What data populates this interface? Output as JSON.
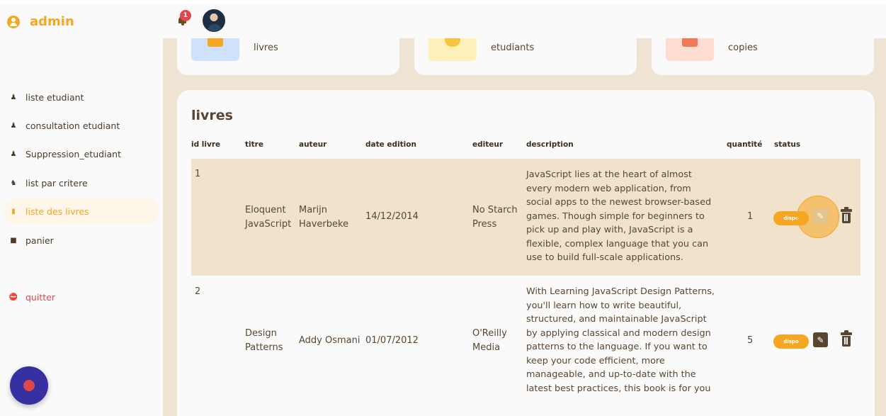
{
  "brand": {
    "title": "admin"
  },
  "header": {
    "notification_count": "1"
  },
  "sidebar": {
    "items": [
      {
        "label": "liste etudiant",
        "icon": "users-icon"
      },
      {
        "label": "consultation etudiant",
        "icon": "user-check-icon"
      },
      {
        "label": "Suppression_etudiant",
        "icon": "user-remove-icon"
      },
      {
        "label": "list par critere",
        "icon": "people-icon"
      },
      {
        "label": "liste des livres",
        "icon": "books-icon",
        "active": true
      },
      {
        "label": "panier",
        "icon": "bag-icon"
      },
      {
        "label": "quitter",
        "icon": "quit-icon"
      }
    ]
  },
  "stats": [
    {
      "label": "livres",
      "color": "#cfe2fb"
    },
    {
      "label": "etudiants",
      "color": "#fdf0b8"
    },
    {
      "label": "copies",
      "color": "#fddcd2"
    }
  ],
  "table": {
    "title": "livres",
    "headers": [
      "id livre",
      "titre",
      "auteur",
      "date edition",
      "editeur",
      "description",
      "quantité",
      "status"
    ],
    "rows": [
      {
        "id": "1",
        "titre_l1": "Eloquent",
        "titre_l2": "JavaScript",
        "auteur_l1": "Marijn",
        "auteur_l2": "Haverbeke",
        "date": "14/12/2014",
        "editeur_l1": "No Starch",
        "editeur_l2": "Press",
        "description": [
          "JavaScript lies at the heart of almost",
          "every modern web application, from",
          "social apps to the newest browser-based",
          "games. Though simple for beginners to",
          "pick up and play with, JavaScript is a",
          "flexible, complex language that you can",
          "use to build full-scale applications."
        ],
        "quantite": "1",
        "status": "dispo"
      },
      {
        "id": "2",
        "titre_l1": "Design",
        "titre_l2": "Patterns",
        "auteur_l1": "Addy Osmani",
        "auteur_l2": "",
        "date": "01/07/2012",
        "editeur_l1": "O'Reilly",
        "editeur_l2": "Media",
        "description": [
          "With Learning JavaScript Design Patterns,",
          "you'll learn how to write beautiful,",
          "structured, and maintainable JavaScript",
          "by applying classical and modern design",
          "patterns to the language. If you want to",
          "keep your code efficient, more",
          "manageable, and up-to-date with the",
          "latest best practices, this book is for you"
        ],
        "quantite": "5",
        "status": "dispo"
      }
    ]
  },
  "colors": {
    "accent": "#f5a623",
    "danger": "#e0464a",
    "background": "#efe4d4",
    "row_highlight": "#f1e3cb",
    "fab": "#3730a3"
  }
}
